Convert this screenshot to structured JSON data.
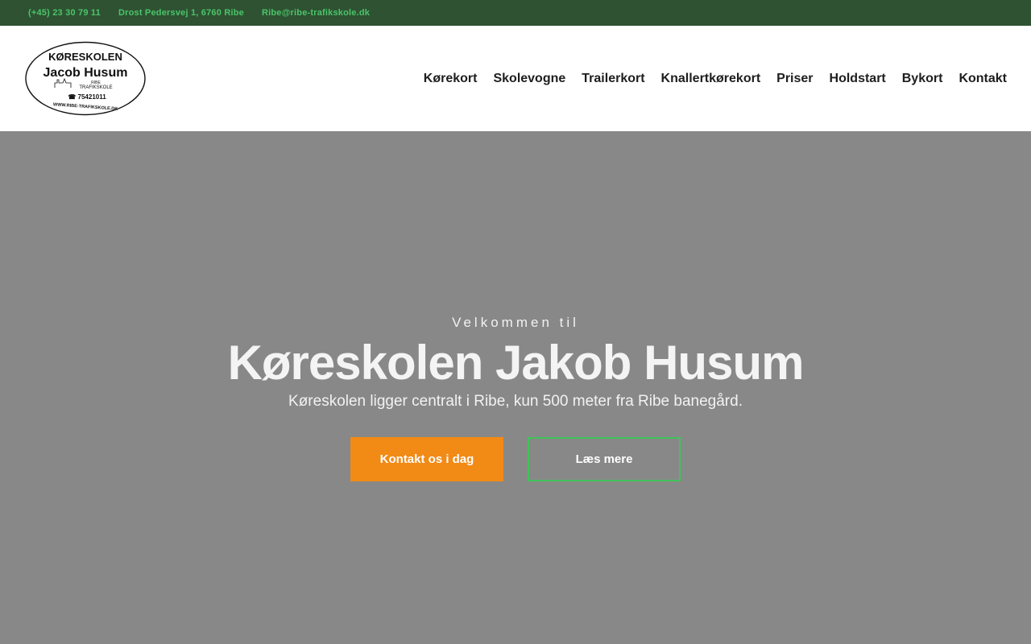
{
  "topbar": {
    "phone": "(+45) 23 30 79 11",
    "address": "Drost Pedersvej 1, 6760 Ribe",
    "email": "Ribe@ribe-trafikskole.dk"
  },
  "logo": {
    "line1": "KØRESKOLEN",
    "line2": "Jacob Husum",
    "line3": "RIBE",
    "line4": "TRAFIKSKOLE",
    "phone": "☎ 75421011",
    "url": "WWW.RIBE-TRAFIKSKOLE.DK"
  },
  "nav": {
    "items": [
      "Kørekort",
      "Skolevogne",
      "Trailerkort",
      "Knallertkørekort",
      "Priser",
      "Holdstart",
      "Bykort",
      "Kontakt"
    ]
  },
  "hero": {
    "eyebrow": "Velkommen til",
    "title": "Køreskolen Jakob Husum",
    "subtitle": "Køreskolen ligger centralt i Ribe, kun 500 meter fra Ribe banegård.",
    "primary_button": "Kontakt os i dag",
    "secondary_button": "Læs mere"
  },
  "colors": {
    "topbar_bg": "#2e5232",
    "topbar_text": "#4bc46a",
    "hero_bg": "#888888",
    "primary_button": "#f28a16",
    "secondary_border": "#3fc35b"
  }
}
